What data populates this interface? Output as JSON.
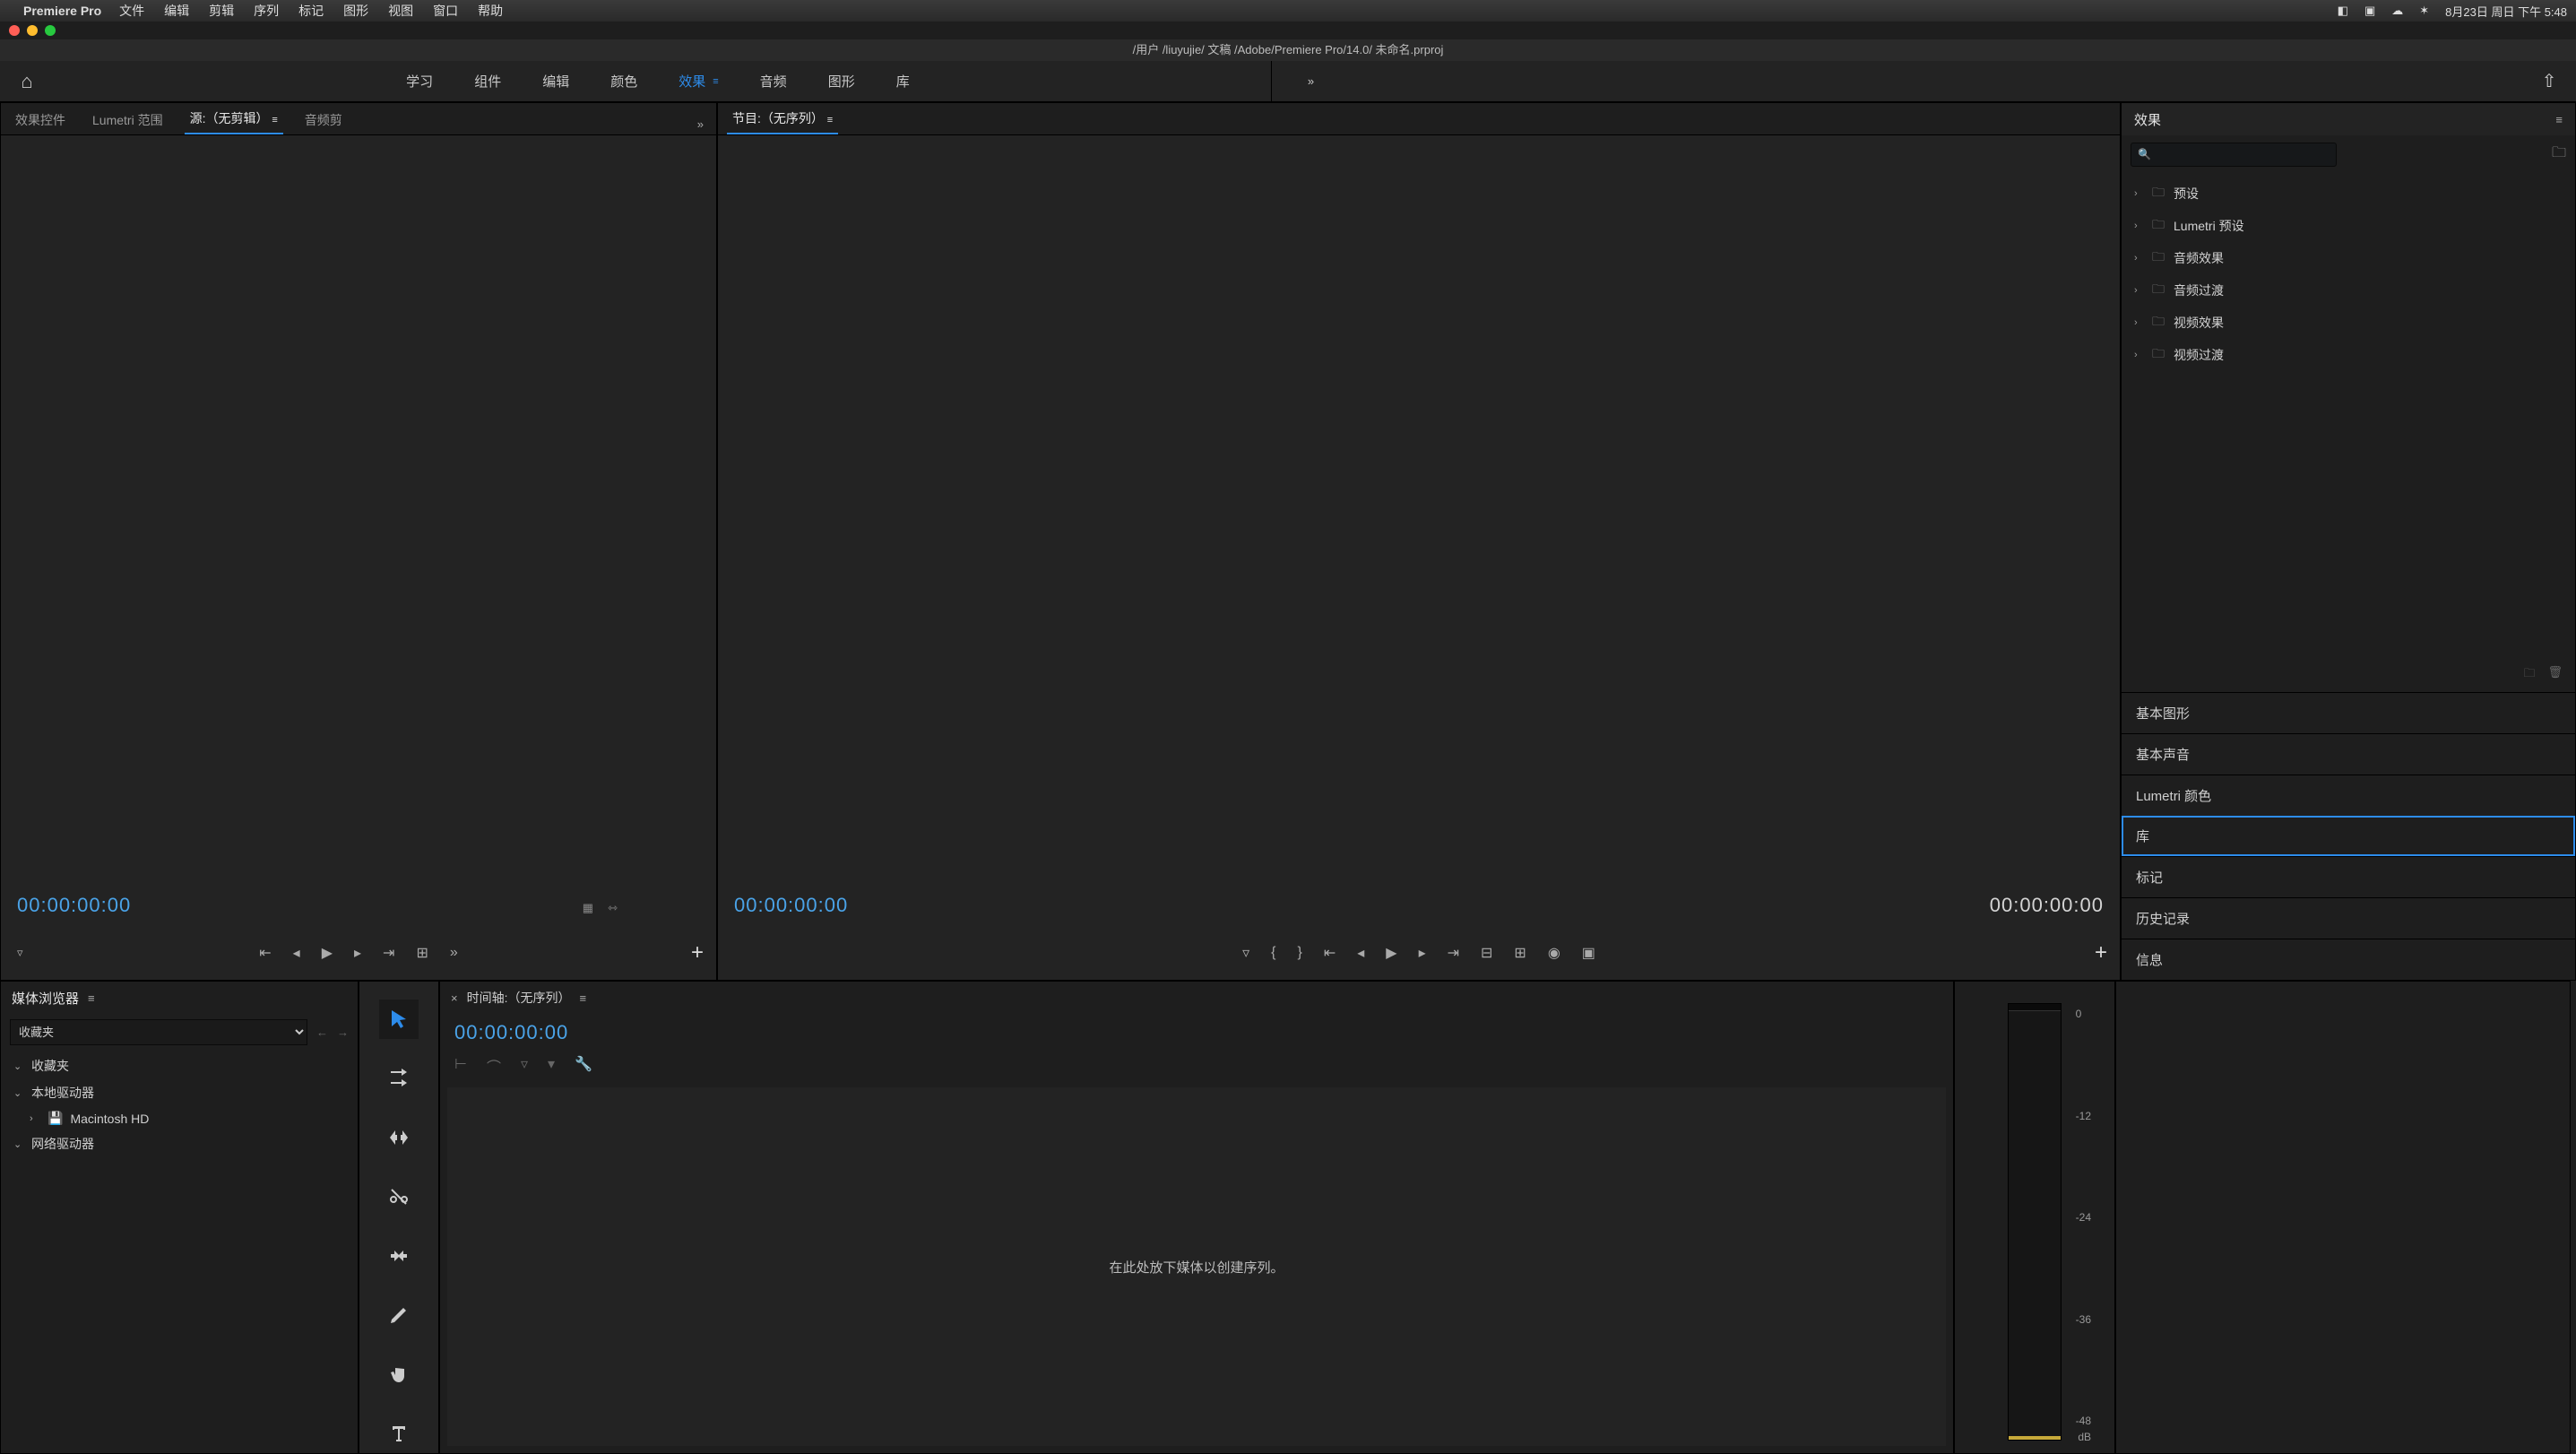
{
  "mac": {
    "app_name": "Premiere Pro",
    "menus": [
      "文件",
      "编辑",
      "剪辑",
      "序列",
      "标记",
      "图形",
      "视图",
      "窗口",
      "帮助"
    ],
    "status_date": "8月23日 周日 下午 5:48"
  },
  "title_path": "/用户 /liuyujie/ 文稿 /Adobe/Premiere Pro/14.0/ 未命名.prproj",
  "workspaces": {
    "items": [
      "学习",
      "组件",
      "编辑",
      "颜色",
      "效果",
      "音频",
      "图形",
      "库"
    ],
    "active_index": 4
  },
  "source_panel": {
    "tabs": [
      "效果控件",
      "Lumetri 范围",
      "源:（无剪辑）",
      "音频剪"
    ],
    "active_index": 2,
    "timecode": "00:00:00:00"
  },
  "program_panel": {
    "tab": "节目:（无序列）",
    "timecode_left": "00:00:00:00",
    "timecode_right": "00:00:00:00"
  },
  "effects": {
    "title": "效果",
    "search_placeholder": "",
    "folders": [
      "预设",
      "Lumetri 预设",
      "音频效果",
      "音频过渡",
      "视频效果",
      "视频过渡"
    ]
  },
  "side_sections": [
    "基本图形",
    "基本声音",
    "Lumetri 颜色",
    "库",
    "标记",
    "历史记录",
    "信息"
  ],
  "side_selected_index": 3,
  "media_browser": {
    "title": "媒体浏览器",
    "select_value": "收藏夹",
    "tree": {
      "fav": "收藏夹",
      "local": "本地驱动器",
      "mac_hd": "Macintosh HD",
      "net": "网络驱动器"
    }
  },
  "timeline": {
    "title": "时间轴:（无序列）",
    "timecode": "00:00:00:00",
    "empty_msg": "在此处放下媒体以创建序列。"
  },
  "meter": {
    "ticks": [
      "0",
      "-12",
      "-24",
      "-36",
      "-48"
    ],
    "unit": "dB"
  }
}
